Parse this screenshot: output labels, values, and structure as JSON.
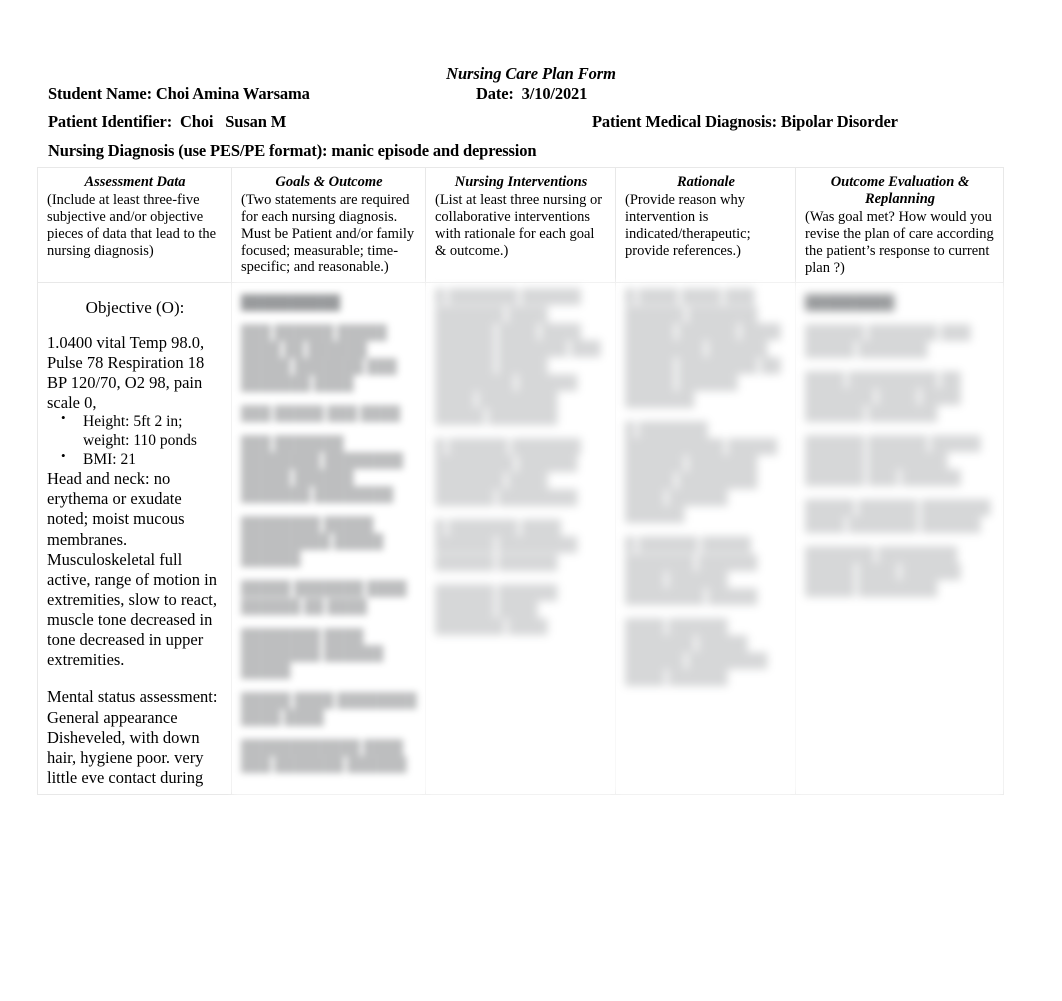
{
  "document": {
    "title": "Nursing Care Plan Form",
    "header": {
      "student_name": "Student Name: Choi Amina Warsama",
      "date": "Date:  3/10/2021",
      "patient_identifier": "Patient Identifier:  Choi   Susan M",
      "patient_medical_diagnosis": "Patient Medical Diagnosis: Bipolar Disorder",
      "nursing_diagnosis": "Nursing Diagnosis (use PES/PE format): manic episode and depression"
    },
    "table": {
      "columns": [
        {
          "id": "assessment-data",
          "title": "Assessment Data",
          "instructions": "(Include   at least three-five subjective and/or objective pieces of data that lead to the nursing diagnosis)"
        },
        {
          "id": "goals-outcome",
          "title": "Goals & Outcome",
          "instructions": "(Two statements are required for each nursing diagnosis.  Must be Patient and/or family focused; measurable; time-specific; and reasonable.)"
        },
        {
          "id": "nursing-interventions",
          "title": "Nursing Interventions",
          "instructions": "(List at least three nursing or collaborative interventions with rationale for each goal & outcome.)"
        },
        {
          "id": "rationale",
          "title": "Rationale",
          "instructions": "(Provide reason why intervention is indicated/therapeutic; provide references.)"
        },
        {
          "id": "outcome-evaluation-replanning",
          "title": "Outcome Evaluation & Replanning",
          "instructions": "(Was goal met?  How would you revise the plan of care according the patient’s response to current plan ?)"
        }
      ],
      "body": {
        "assessment_data": {
          "heading": "Objective (O):",
          "vitals": "1.0400 vital Temp 98.0, Pulse 78 Respiration 18 BP 120/70, O2 98, pain scale 0,",
          "bullets": [
            "Height: 5ft 2 in; weight: 110 ponds",
            " BMI: 21"
          ],
          "head_and_neck": "Head and neck: no erythema or exudate noted; moist mucous membranes.",
          "musculoskeletal": "Musculoskeletal full active, range of motion in extremities, slow to react, muscle tone decreased in tone decreased in upper extremities.",
          "mental_status": "Mental status assessment: General appearance Disheveled, with down hair, hygiene poor. very little eve contact during"
        },
        "goals_outcome": {
          "obscured": true,
          "blocks": [
            "██████████",
            "███ ██████ █████ ████ ██ ██████ █████ ███████ ███ ███████ ████",
            "███ █████ ███ ████",
            "███ ███████ ████████ ████████ █████ ██████ ███████ ████████",
            "████████ █████ █████████ █████ ██████",
            "█████ ███████ ████ ██████ ██ ████",
            "████████ ████ ████████ ██████ █████",
            "█████ ████ ████████ ████ ████",
            "████████████ ████ ███ ███████ ██████"
          ]
        },
        "nursing_interventions": {
          "obscured": true,
          "blocks": [
            "█ ███████ ██████ ███████ ████ ██████ ████ ████ ██████ ███████ ███ ██████ █████ ████████ ██████ ████ ████████ █████ ███████",
            "█ ██████ ███████ ████████ ██████ ███████ ████ ██████ ████████",
            "█ ███████ ████ ██████ ████████ ██████ ██████",
            "██████ ██████ ██████ ████ ███████ ████"
          ]
        },
        "rationale": {
          "obscured": true,
          "blocks": [
            "█ ████ ████ ███ ██████ ███████ █████ ██████ ████ ████████ ██████ █████ ████████ ██ █████ ██████ ███████",
            "█ ███████ ██████████ █████ ██████ ███████ █████ ████████ ████ ██████ ██████",
            "█ ██████ █████ ███████ ██████ ████ ██████ ████████ █████",
            "████ ██████ ███████ █████ ██████ ████████ ████ ██████"
          ]
        },
        "outcome_evaluation": {
          "obscured": true,
          "blocks": [
            "█████████",
            "██████ ███████ ███ █████ ███████",
            "████ █████████ ██ ███████ ████ ████ ██████ ███████",
            "██████ ██████ █████ ██████ ████████ ██████ ███ ██████",
            "█████ ██████ ███████ ████ ███████ ██████",
            "███████ ████████ █████ ████ ██████ █████ ████████"
          ]
        }
      }
    }
  }
}
